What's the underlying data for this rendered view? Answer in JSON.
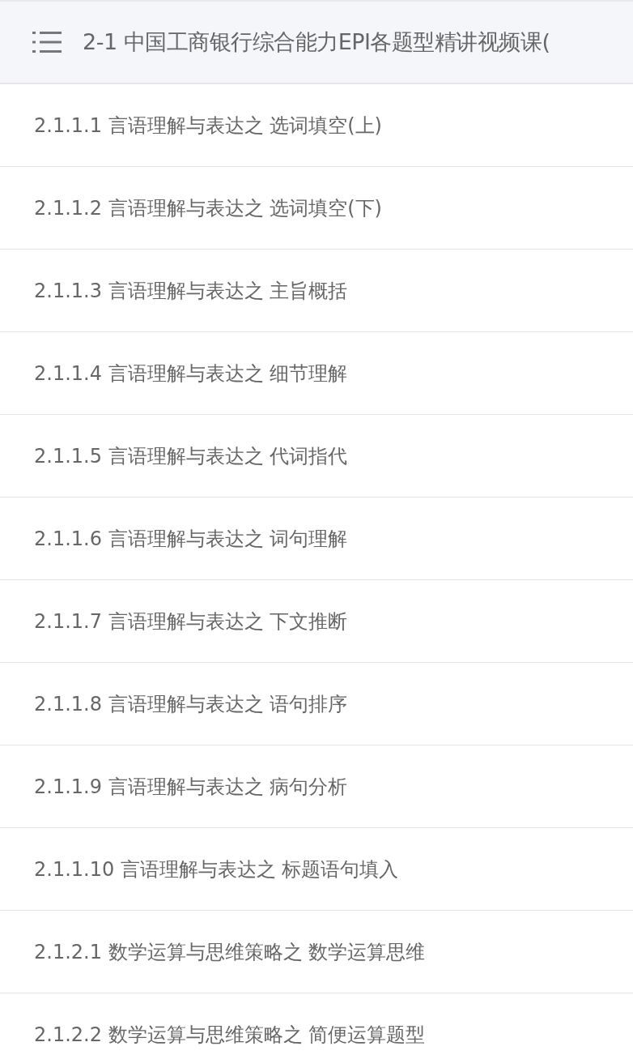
{
  "header": {
    "title": "2-1 中国工商银行综合能力EPI各题型精讲视频课("
  },
  "lessons": [
    {
      "title": "2.1.1.1 言语理解与表达之 选词填空(上)"
    },
    {
      "title": "2.1.1.2 言语理解与表达之 选词填空(下)"
    },
    {
      "title": "2.1.1.3 言语理解与表达之 主旨概括"
    },
    {
      "title": "2.1.1.4 言语理解与表达之 细节理解"
    },
    {
      "title": "2.1.1.5 言语理解与表达之 代词指代"
    },
    {
      "title": "2.1.1.6 言语理解与表达之 词句理解"
    },
    {
      "title": "2.1.1.7 言语理解与表达之 下文推断"
    },
    {
      "title": "2.1.1.8 言语理解与表达之 语句排序"
    },
    {
      "title": "2.1.1.9 言语理解与表达之 病句分析"
    },
    {
      "title": "2.1.1.10 言语理解与表达之 标题语句填入"
    },
    {
      "title": "2.1.2.1 数学运算与思维策略之 数学运算思维"
    },
    {
      "title": "2.1.2.2 数学运算与思维策略之 简便运算题型"
    }
  ]
}
